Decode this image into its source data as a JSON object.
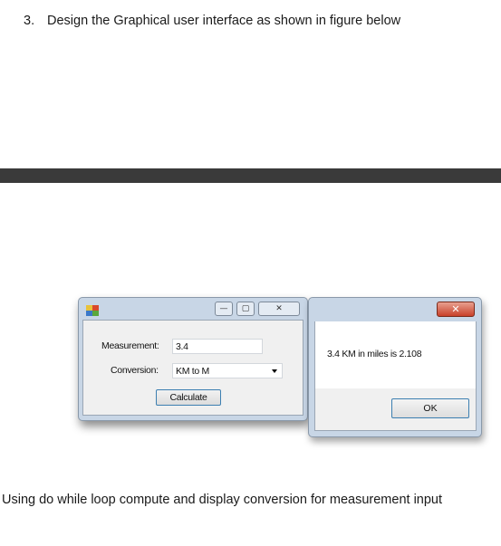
{
  "question": {
    "number": "3.",
    "text": "Design the Graphical user interface as shown in figure below"
  },
  "form_window": {
    "title_buttons": {
      "minimize": "—",
      "maximize": "▢",
      "close": "✕"
    },
    "measurement_label": "Measurement:",
    "measurement_value": "3.4",
    "conversion_label": "Conversion:",
    "conversion_selected": "KM to M",
    "calculate_label": "Calculate"
  },
  "message_box": {
    "close_label": "✕",
    "message": "3.4 KM in miles is 2.108",
    "ok_label": "OK"
  },
  "footer_text": "Using do while loop compute and display  conversion for measurement input"
}
